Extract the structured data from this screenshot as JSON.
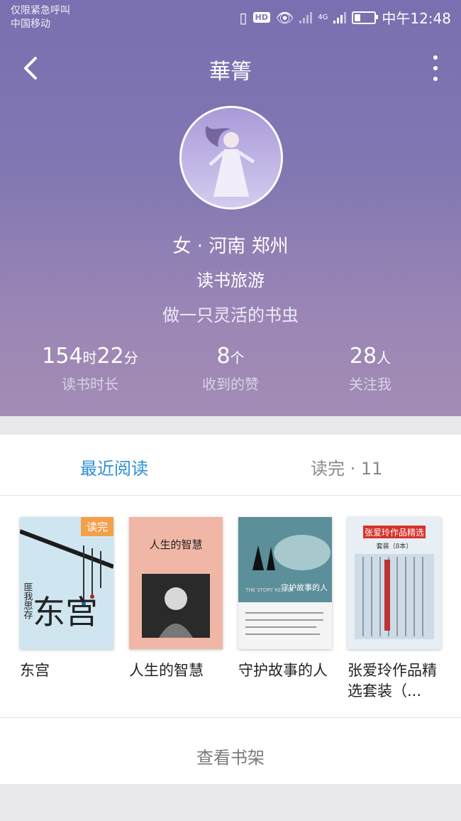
{
  "status_bar": {
    "carrier_line1": "仅限紧急呼叫",
    "carrier_line2": "中国移动",
    "hd": "HD",
    "network": "4G",
    "time": "中午12:48"
  },
  "nav": {
    "title": "華箐"
  },
  "profile": {
    "gender_location": "女 · 河南 郑州",
    "hobby": "读书旅游",
    "motto": "做一只灵活的书虫"
  },
  "stats": [
    {
      "value1": "154",
      "unit1": "时",
      "value2": "22",
      "unit2": "分",
      "label": "读书时长"
    },
    {
      "value": "8",
      "unit": "个",
      "label": "收到的赞"
    },
    {
      "value": "28",
      "unit": "人",
      "label": "关注我"
    }
  ],
  "tabs": {
    "recent": "最近阅读",
    "done": "读完 · 11"
  },
  "books": [
    {
      "title": "东宫",
      "badge": "读完",
      "cover_texts": [
        "东宫",
        "匪我思存"
      ]
    },
    {
      "title": "人生的智慧",
      "cover_texts": [
        "人生的智慧"
      ]
    },
    {
      "title": "守护故事的人",
      "cover_texts": [
        "守护故事的人",
        "THE STORY KEEPER"
      ]
    },
    {
      "title": "张爱玲作品精选套装（...",
      "cover_texts": [
        "张爱玲作品精选",
        "套装（8本）"
      ]
    }
  ],
  "shelf_button": "查看书架",
  "colors": {
    "accent": "#2d8fd6",
    "header_top": "#7a6fb0",
    "header_bottom": "#a48cb4",
    "badge": "#f2a04a"
  }
}
